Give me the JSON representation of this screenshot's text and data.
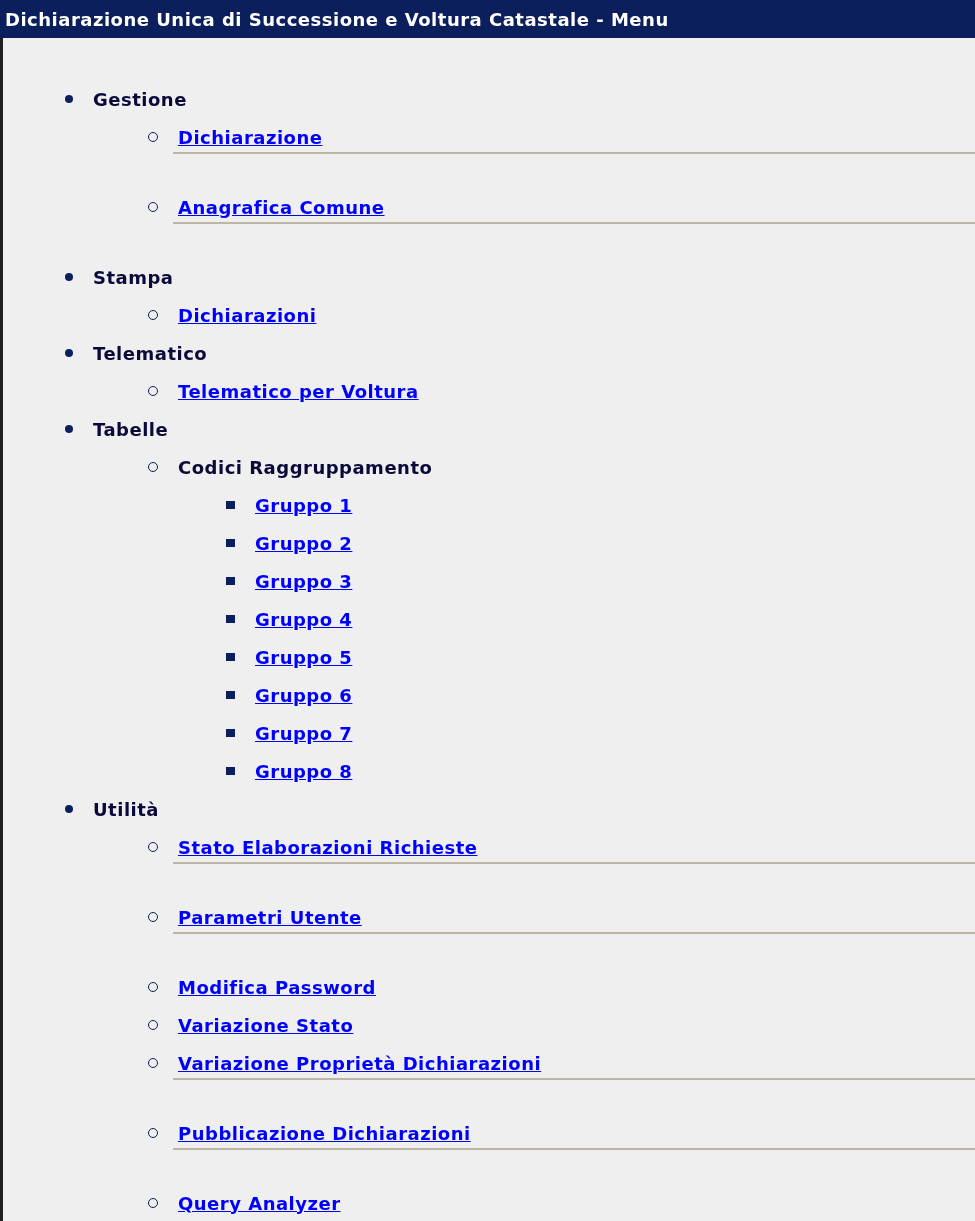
{
  "window": {
    "title": "Dichiarazione Unica di Successione e Voltura Catastale - Menu"
  },
  "menu": [
    {
      "label": "Gestione",
      "kind": "heading",
      "divider": false,
      "children": [
        {
          "label": "Dichiarazione",
          "kind": "link",
          "divider": true
        },
        {
          "label": "Anagrafica Comune",
          "kind": "link",
          "divider": true
        }
      ]
    },
    {
      "label": "Stampa",
      "kind": "heading",
      "divider": false,
      "children": [
        {
          "label": "Dichiarazioni",
          "kind": "link",
          "divider": false
        }
      ]
    },
    {
      "label": "Telematico",
      "kind": "heading",
      "divider": false,
      "children": [
        {
          "label": "Telematico per Voltura",
          "kind": "link",
          "divider": false
        }
      ]
    },
    {
      "label": "Tabelle",
      "kind": "heading",
      "divider": false,
      "children": [
        {
          "label": "Codici Raggruppamento",
          "kind": "heading",
          "divider": false,
          "children": [
            {
              "label": "Gruppo 1",
              "kind": "link",
              "divider": false
            },
            {
              "label": "Gruppo 2",
              "kind": "link",
              "divider": false
            },
            {
              "label": "Gruppo 3",
              "kind": "link",
              "divider": false
            },
            {
              "label": "Gruppo 4",
              "kind": "link",
              "divider": false
            },
            {
              "label": "Gruppo 5",
              "kind": "link",
              "divider": false
            },
            {
              "label": "Gruppo 6",
              "kind": "link",
              "divider": false
            },
            {
              "label": "Gruppo 7",
              "kind": "link",
              "divider": false
            },
            {
              "label": "Gruppo 8",
              "kind": "link",
              "divider": false
            }
          ]
        }
      ]
    },
    {
      "label": "Utilità",
      "kind": "heading",
      "divider": false,
      "children": [
        {
          "label": "Stato Elaborazioni Richieste",
          "kind": "link",
          "divider": true
        },
        {
          "label": "Parametri Utente",
          "kind": "link",
          "divider": true
        },
        {
          "label": "Modifica Password",
          "kind": "link",
          "divider": false
        },
        {
          "label": "Variazione Stato",
          "kind": "link",
          "divider": false
        },
        {
          "label": "Variazione Proprietà Dichiarazioni",
          "kind": "link",
          "divider": true
        },
        {
          "label": "Pubblicazione Dichiarazioni",
          "kind": "link",
          "divider": true
        },
        {
          "label": "Query Analyzer",
          "kind": "link",
          "divider": false
        }
      ]
    }
  ]
}
